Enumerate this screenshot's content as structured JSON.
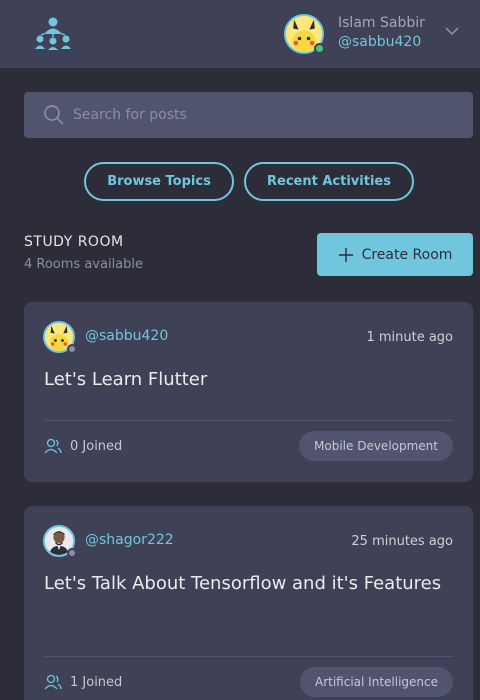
{
  "header": {
    "user_name": "Islam Sabbir",
    "user_handle": "@sabbu420",
    "logo_icon": "people-network-icon",
    "menu_icon": "chevron-down-icon"
  },
  "search": {
    "placeholder": "Search for posts",
    "icon": "search-icon"
  },
  "nav_buttons": {
    "browse_topics": "Browse Topics",
    "recent_activities": "Recent Activities"
  },
  "study_room": {
    "title": "STUDY ROOM",
    "count_label": "4 Rooms available",
    "create_label": "Create Room"
  },
  "rooms": [
    {
      "host_handle": "@sabbu420",
      "time": "1 minute ago",
      "title": "Let's Learn Flutter",
      "joined": "0 Joined",
      "topic": "Mobile Development"
    },
    {
      "host_handle": "@shagor222",
      "time": "25 minutes ago",
      "title": "Let's Talk About Tensorflow and it's Features",
      "joined": "1 Joined",
      "topic": "Artificial Intelligence"
    }
  ],
  "colors": {
    "background": "#2d2d39",
    "surface": "#3f4156",
    "accent": "#71c6dd",
    "input": "#51546e",
    "online": "#4cc27a",
    "muted": "#8b8ea6"
  }
}
